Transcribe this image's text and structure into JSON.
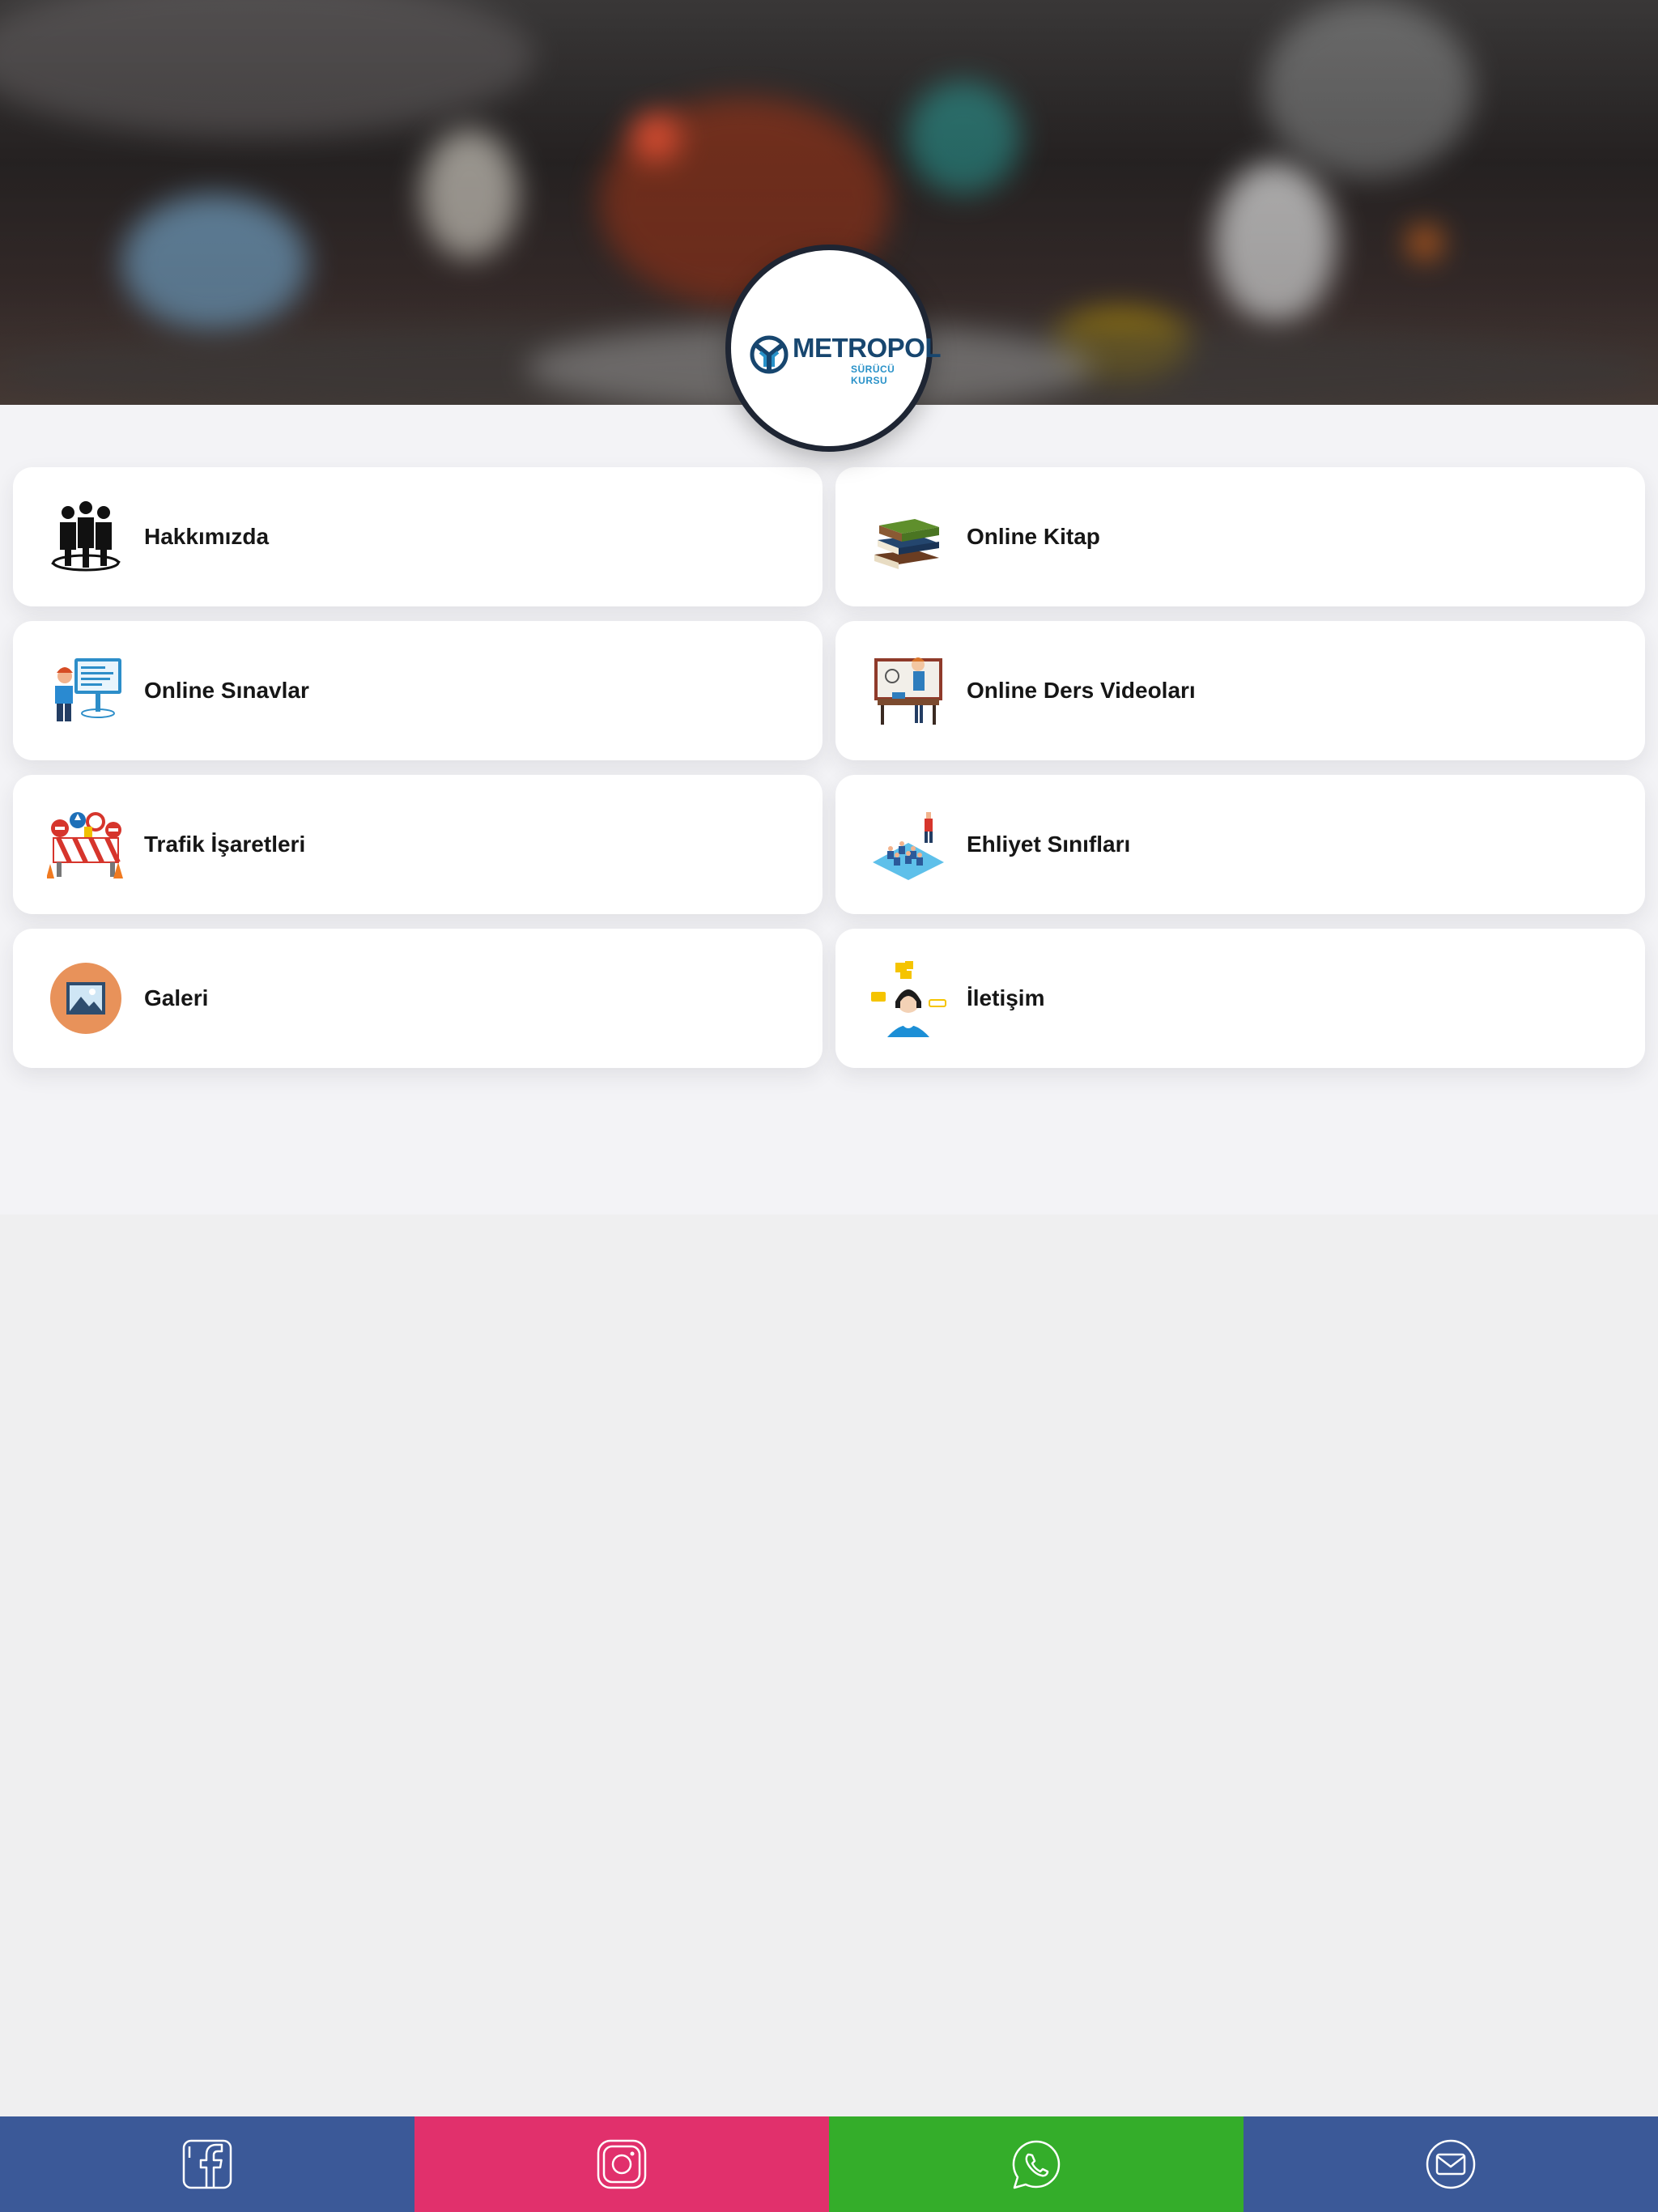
{
  "brand": {
    "name": "METROPOL",
    "subtitle": "SÜRÜCÜ KURSU",
    "primary_color": "#17466f",
    "accent_color": "#2891c8"
  },
  "hero": {
    "image": "blurred-city-traffic-photo"
  },
  "menu": {
    "items": [
      {
        "label": "Hakkımızda",
        "icon": "team-people-icon"
      },
      {
        "label": "Online Kitap",
        "icon": "books-icon"
      },
      {
        "label": "Online Sınavlar",
        "icon": "online-exam-computer-icon"
      },
      {
        "label": "Online Ders Videoları",
        "icon": "teacher-presentation-icon"
      },
      {
        "label": "Trafik İşaretleri",
        "icon": "traffic-signs-icon"
      },
      {
        "label": "Ehliyet Sınıfları",
        "icon": "classroom-icon"
      },
      {
        "label": "Galeri",
        "icon": "gallery-image-icon"
      },
      {
        "label": "İletişim",
        "icon": "contact-support-icon"
      }
    ]
  },
  "footer": {
    "social": [
      {
        "name": "facebook",
        "icon": "facebook-icon",
        "color": "#3b5998"
      },
      {
        "name": "instagram",
        "icon": "instagram-icon",
        "color": "#e1306c"
      },
      {
        "name": "whatsapp",
        "icon": "whatsapp-icon",
        "color": "#34ad2a"
      },
      {
        "name": "email",
        "icon": "mail-icon",
        "color": "#3b5998"
      }
    ]
  }
}
